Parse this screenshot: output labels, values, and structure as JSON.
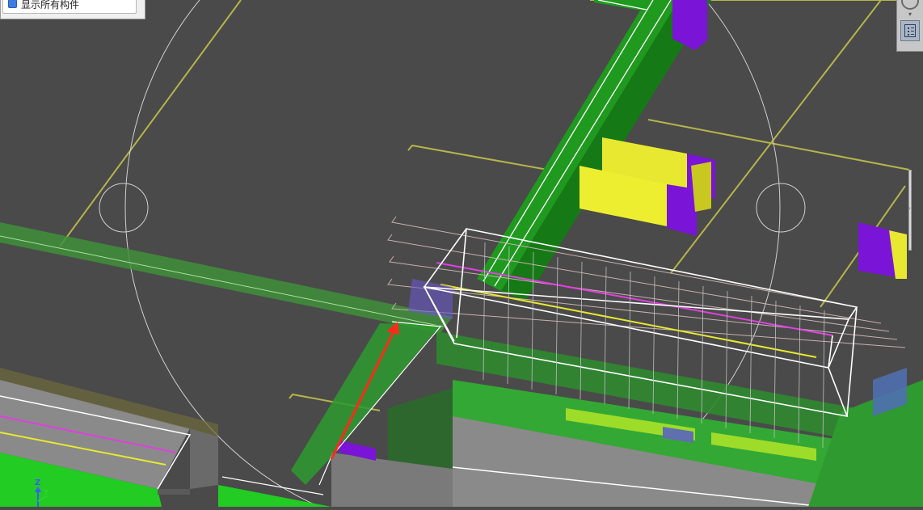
{
  "layer_panel": {
    "checkbox_checked": true,
    "label": "显示所有构件"
  },
  "toolbar": {
    "orbit_icon": "orbit-circle-icon",
    "orbit_caret": "▾",
    "view_icon": "view-grid-icon"
  },
  "scrollbar": {
    "arrow": "›"
  },
  "axis_triad": {
    "z_label": "Z",
    "y_label": "Y"
  },
  "colors": {
    "background": "#4a4a4a",
    "beam_green": "#22a322",
    "column_yellow": "#eeee30",
    "column_purple": "#7a14d6",
    "grid_line": "#b8b84a",
    "selection_box": "#ffffff",
    "rebar_magenta": "#e040e0",
    "pointer_arrow": "#ff2a1a",
    "orbit_circle": "#d8d8d8",
    "slab_gray": "#8a8a8a"
  }
}
